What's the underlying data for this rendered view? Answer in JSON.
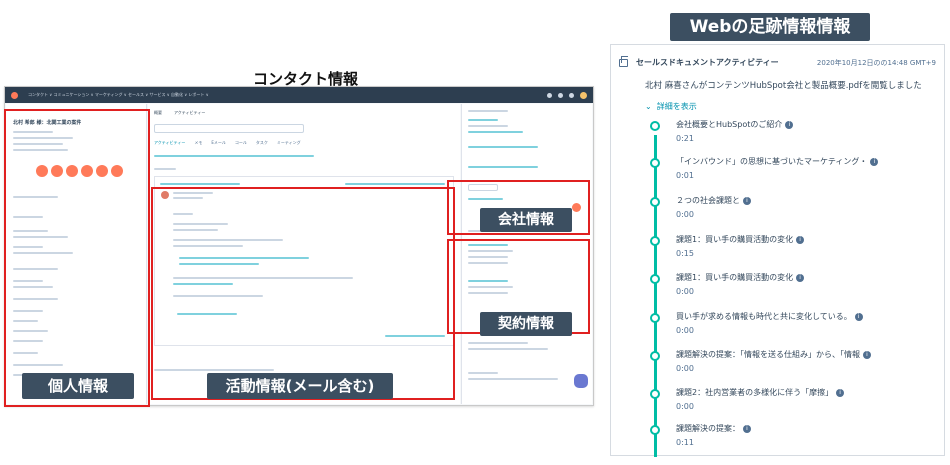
{
  "labels": {
    "web_title": "Webの足跡情報情報",
    "contact_title": "コンタクト情報",
    "personal": "個人情報",
    "activity": "活動情報(メール含む)",
    "company": "会社情報",
    "contract": "契約情報"
  },
  "crm": {
    "nav": "コンタクト ∨  コミュニケーション ∨  マーケティング ∨  セールス ∨  サービス ∨  自動化 ∨  レポート ∨",
    "contact_name": "北村 希郎 様：北関工業の案件",
    "tabs": [
      "概要",
      "アクティビティー"
    ],
    "activity_tabs": [
      "アクティビティー",
      "メモ",
      "Eメール",
      "コール",
      "タスク",
      "ミーティング"
    ],
    "section_company": "会社",
    "section_deal": "取引"
  },
  "activity": {
    "type_label": "セールスドキュメントアクティビティー",
    "date": "2020年10月12日のの14:48 GMT+9",
    "description": "北村 麻喜さんがコンテンツHubSpot会社と製品概要.pdfを閲覧しました",
    "details_toggle": "詳細を表示",
    "items": [
      {
        "title": "会社概要とHubSpotのご紹介",
        "time": "0:21"
      },
      {
        "title": "「インバウンド」の思想に基づいたマーケティング・",
        "time": "0:01"
      },
      {
        "title": "２つの社会課題と",
        "time": "0:00"
      },
      {
        "title": "課題1：買い手の購買活動の変化",
        "time": "0:15"
      },
      {
        "title": "課題1：買い手の購買活動の変化",
        "time": "0:00"
      },
      {
        "title": "買い手が求める情報も時代と共に変化している。",
        "time": "0:00"
      },
      {
        "title": "課題解決の提案：「情報を送る仕組み」から、「情報",
        "time": "0:00"
      },
      {
        "title": "課題2：社内営業者の多様化に伴う「摩擦」",
        "time": "0:00"
      },
      {
        "title": "課題解決の提案：",
        "time": "0:11"
      }
    ]
  },
  "colors": {
    "accent": "#00bda5",
    "highlight": "#e02020",
    "orange": "#ff7a59",
    "label_bg": "#3c4f61"
  }
}
